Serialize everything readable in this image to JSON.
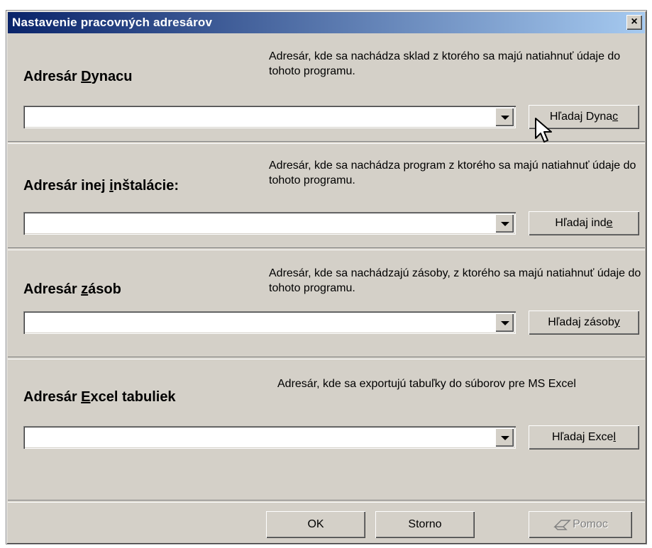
{
  "window": {
    "title": "Nastavenie pracovných adresárov",
    "close_label": "×"
  },
  "sections": [
    {
      "label_pre": "Adresár ",
      "label_key": "D",
      "label_post": "ynacu",
      "description": "Adresár, kde sa nachádza sklad z ktorého sa majú natiahnuť údaje do tohoto programu.",
      "value": "",
      "button_pre": "Hľadaj Dyna",
      "button_key": "c",
      "button_post": ""
    },
    {
      "label_pre": "Adresár inej ",
      "label_key": "i",
      "label_post": "nštalácie:",
      "description": "Adresár, kde sa nachádza program z ktorého sa majú natiahnuť údaje do tohoto programu.",
      "value": "",
      "button_pre": "Hľadaj ind",
      "button_key": "e",
      "button_post": ""
    },
    {
      "label_pre": "Adresár ",
      "label_key": "z",
      "label_post": "ásob",
      "description": "Adresár, kde sa nachádzajú zásoby, z ktorého sa majú natiahnuť údaje do tohoto programu.",
      "value": "",
      "button_pre": "Hľadaj zásob",
      "button_key": "y",
      "button_post": ""
    },
    {
      "label_pre": "Adresár ",
      "label_key": "E",
      "label_post": "xcel tabuliek",
      "description": "Adresár, kde sa exportujú tabuľky do súborov pre MS Excel",
      "value": "",
      "button_pre": "Hľadaj Exce",
      "button_key": "l",
      "button_post": ""
    }
  ],
  "footer": {
    "ok": "OK",
    "cancel": "Storno",
    "help": "Pomoc"
  }
}
